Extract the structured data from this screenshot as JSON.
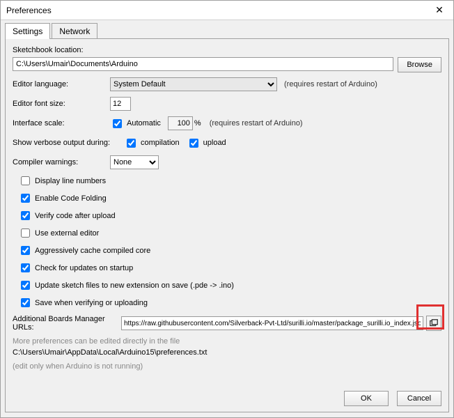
{
  "window": {
    "title": "Preferences"
  },
  "tabs": {
    "settings": "Settings",
    "network": "Network"
  },
  "sketchbook": {
    "label": "Sketchbook location:",
    "value": "C:\\Users\\Umair\\Documents\\Arduino",
    "browse": "Browse"
  },
  "editor_lang": {
    "label": "Editor language:",
    "value": "System Default",
    "hint": "(requires restart of Arduino)"
  },
  "font_size": {
    "label": "Editor font size:",
    "value": "12"
  },
  "interface_scale": {
    "label": "Interface scale:",
    "auto_label": "Automatic",
    "auto_checked": true,
    "value": "100",
    "pct": "%",
    "hint": "(requires restart of Arduino)"
  },
  "verbose": {
    "label": "Show verbose output during:",
    "compilation_label": "compilation",
    "compilation_checked": true,
    "upload_label": "upload",
    "upload_checked": true
  },
  "compiler_warnings": {
    "label": "Compiler warnings:",
    "value": "None"
  },
  "options": [
    {
      "label": "Display line numbers",
      "checked": false
    },
    {
      "label": "Enable Code Folding",
      "checked": true
    },
    {
      "label": "Verify code after upload",
      "checked": true
    },
    {
      "label": "Use external editor",
      "checked": false
    },
    {
      "label": "Aggressively cache compiled core",
      "checked": true
    },
    {
      "label": "Check for updates on startup",
      "checked": true
    },
    {
      "label": "Update sketch files to new extension on save (.pde -> .ino)",
      "checked": true
    },
    {
      "label": "Save when verifying or uploading",
      "checked": true
    }
  ],
  "boards_url": {
    "label": "Additional Boards Manager URLs:",
    "value": "https://raw.githubusercontent.com/Silverback-Pvt-Ltd/surilli.io/master/package_surilli.io_index.json"
  },
  "notes": {
    "line1": "More preferences can be edited directly in the file",
    "path": "C:\\Users\\Umair\\AppData\\Local\\Arduino15\\preferences.txt",
    "line2": "(edit only when Arduino is not running)"
  },
  "buttons": {
    "ok": "OK",
    "cancel": "Cancel"
  }
}
